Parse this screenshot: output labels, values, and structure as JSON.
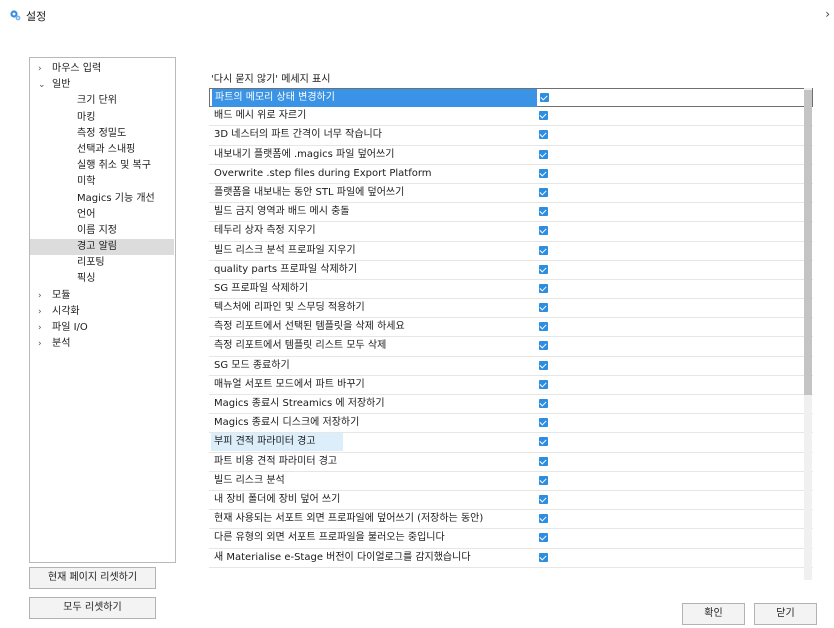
{
  "window": {
    "title": "설정",
    "icon": "gear-icon",
    "chevron": "›"
  },
  "tree": {
    "items": [
      {
        "label": "마우스 입력",
        "arrow": "›",
        "level": 0
      },
      {
        "label": "일반",
        "arrow": "⌄",
        "level": 0
      },
      {
        "label": "크기 단위",
        "level": 1
      },
      {
        "label": "마킹",
        "level": 1
      },
      {
        "label": "측정 정밀도",
        "level": 1
      },
      {
        "label": "선택과 스내핑",
        "level": 1
      },
      {
        "label": "실행 취소 및 복구",
        "level": 1
      },
      {
        "label": "미학",
        "level": 1
      },
      {
        "label": "Magics 기능 개선",
        "level": 1
      },
      {
        "label": "언어",
        "level": 1
      },
      {
        "label": "이름 지정",
        "level": 1
      },
      {
        "label": "경고 알림",
        "level": 1,
        "selected": true
      },
      {
        "label": "리포팅",
        "level": 1
      },
      {
        "label": "픽싱",
        "level": 1
      },
      {
        "label": "모듈",
        "arrow": "›",
        "level": 0
      },
      {
        "label": "시각화",
        "arrow": "›",
        "level": 0
      },
      {
        "label": "파일 I/O",
        "arrow": "›",
        "level": 0
      },
      {
        "label": "분석",
        "arrow": "›",
        "level": 0
      }
    ]
  },
  "buttons": {
    "reset_page": "현재 페이지 리셋하기",
    "reset_all": "모두 리셋하기",
    "ok": "확인",
    "close": "닫기"
  },
  "list": {
    "header": "'다시 묻지 않기' 메세지 표시",
    "rows": [
      {
        "label": "파트의 메모리 상태 변경하기",
        "checked": true,
        "selected": true
      },
      {
        "label": "배드 메시 위로 자르기",
        "checked": true
      },
      {
        "label": "3D 네스터의 파트 간격이 너무 작습니다",
        "checked": true
      },
      {
        "label": "내보내기 플랫폼에 .magics 파일 덮어쓰기",
        "checked": true
      },
      {
        "label": "Overwrite .step files during Export Platform",
        "checked": true
      },
      {
        "label": "플랫폼을 내보내는 동안 STL 파일에 덮어쓰기",
        "checked": true
      },
      {
        "label": "빌드 금지 영역과 배드 메시 충돌",
        "checked": true
      },
      {
        "label": "테두리 상자 측정 지우기",
        "checked": true
      },
      {
        "label": "빌드 리스크 분석 프로파일 지우기",
        "checked": true
      },
      {
        "label": "quality parts 프로파일 삭제하기",
        "checked": true
      },
      {
        "label": "SG 프로파일 삭제하기",
        "checked": true
      },
      {
        "label": "텍스처에 리파인 및 스무딩 적용하기",
        "checked": true
      },
      {
        "label": "측정 리포트에서 선택된 템플릿을 삭제 하세요",
        "checked": true
      },
      {
        "label": "측정 리포트에서 템플릿 리스트 모두 삭제",
        "checked": true
      },
      {
        "label": "SG 모드 종료하기",
        "checked": true
      },
      {
        "label": "매뉴얼 서포트 모드에서 파트 바꾸기",
        "checked": true
      },
      {
        "label": "Magics 종료시 Streamics 에 저장하기",
        "checked": true
      },
      {
        "label": "Magics 종료시 디스크에 저장하기",
        "checked": true
      },
      {
        "label": "부피 견적 파라미터 경고",
        "checked": true,
        "hover": true
      },
      {
        "label": "파트 비용 견적 파라미터 경고",
        "checked": true
      },
      {
        "label": "빌드 리스크 분석",
        "checked": true
      },
      {
        "label": "내 장비 폴더에 장비 덮어 쓰기",
        "checked": true
      },
      {
        "label": "현재 사용되는 서포트 외면 프로파일에 덮어쓰기 (저장하는 동안)",
        "checked": true
      },
      {
        "label": "다른 유형의 외면 서포트 프로파일을 불러오는 중입니다",
        "checked": true
      },
      {
        "label": "새 Materialise e-Stage 버전이 다이얼로그를 감지했습니다",
        "checked": true
      }
    ]
  },
  "colors": {
    "accent": "#3a93e4",
    "checkbox": "#2d8ee0",
    "tree_selected": "#dcdcdc"
  }
}
